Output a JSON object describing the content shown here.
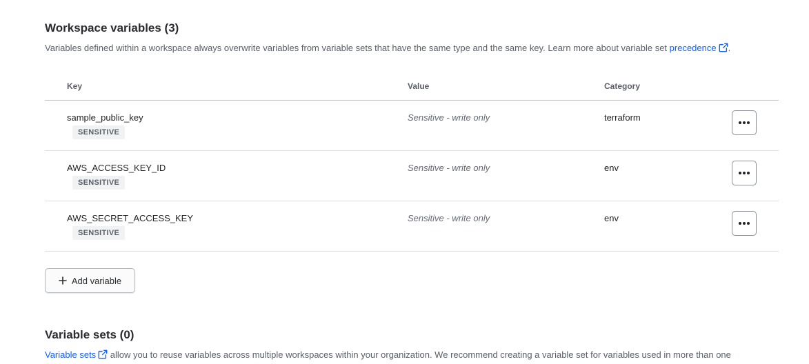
{
  "workspace_variables": {
    "title": "Workspace variables (3)",
    "description_text": "Variables defined within a workspace always overwrite variables from variable sets that have the same type and the same key. Learn more about variable set ",
    "description_link": "precedence",
    "description_end": ".",
    "columns": {
      "key": "Key",
      "value": "Value",
      "category": "Category"
    },
    "rows": [
      {
        "key": "sample_public_key",
        "badge": "SENSITIVE",
        "value": "Sensitive - write only",
        "category": "terraform"
      },
      {
        "key": "AWS_ACCESS_KEY_ID",
        "badge": "SENSITIVE",
        "value": "Sensitive - write only",
        "category": "env"
      },
      {
        "key": "AWS_SECRET_ACCESS_KEY",
        "badge": "SENSITIVE",
        "value": "Sensitive - write only",
        "category": "env"
      }
    ],
    "add_button_label": "Add variable"
  },
  "variable_sets": {
    "title": "Variable sets (0)",
    "description_link": "Variable sets",
    "description_text": " allow you to reuse variables across multiple workspaces within your organization. We recommend creating a variable set for variables used in more than one"
  },
  "colors": {
    "link": "#1060ff",
    "badge_bg": "#f1f2f3",
    "muted_text": "#5a5f69"
  },
  "icons": {
    "external_link": "external-link-icon",
    "more": "more-horizontal-icon",
    "plus": "plus-icon"
  }
}
